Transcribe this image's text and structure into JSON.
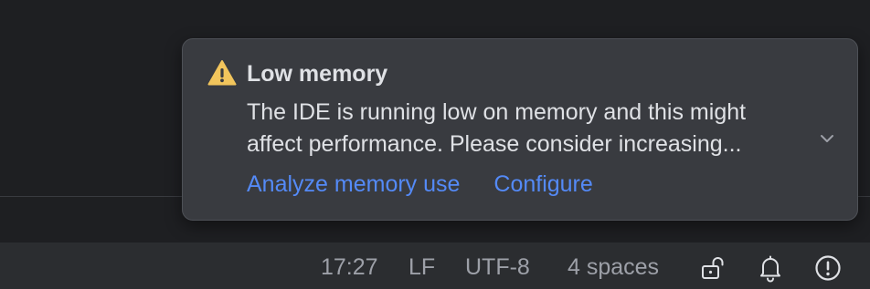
{
  "notification": {
    "title": "Low memory",
    "body_line1": "The IDE is running low on memory and this might",
    "body_line2": "affect performance. Please consider increasing...",
    "actions": {
      "analyze": "Analyze memory use",
      "configure": "Configure"
    },
    "icon": "warning-triangle-icon",
    "expand_icon": "chevron-down-icon",
    "colors": {
      "warning": "#f2c55c",
      "link": "#548af7"
    }
  },
  "status_bar": {
    "cursor_position": "17:27",
    "line_separator": "LF",
    "encoding": "UTF-8",
    "indent": "4 spaces",
    "lock_icon": "unlocked-padlock-icon",
    "notifications_icon": "bell-icon",
    "problems_icon": "exclamation-circle-icon"
  }
}
